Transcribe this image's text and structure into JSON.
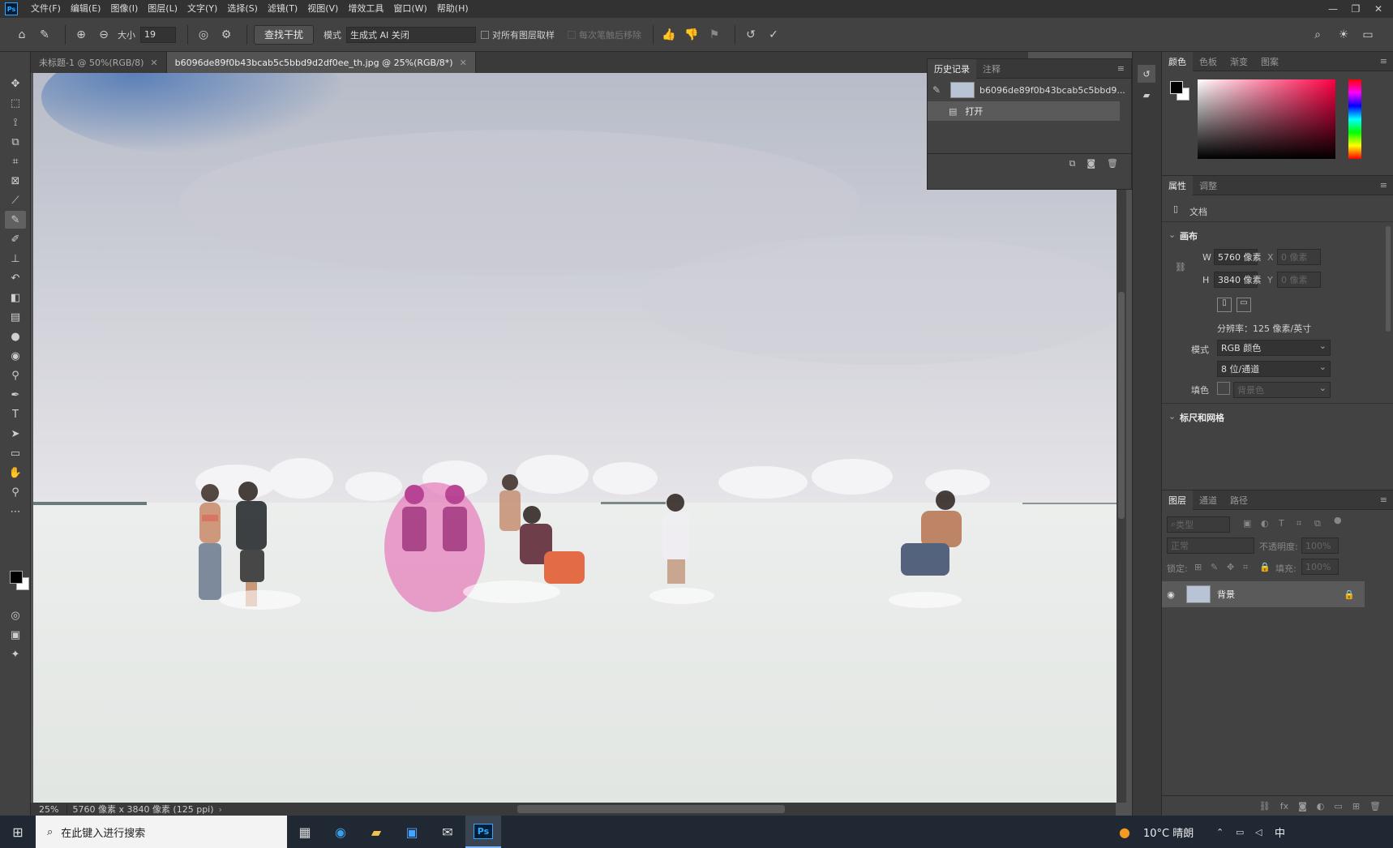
{
  "app": {
    "logo": "Ps"
  },
  "menu": [
    "文件(F)",
    "编辑(E)",
    "图像(I)",
    "图层(L)",
    "文字(Y)",
    "选择(S)",
    "滤镜(T)",
    "视图(V)",
    "增效工具",
    "窗口(W)",
    "帮助(H)"
  ],
  "options": {
    "size_label": "大小",
    "size_value": "19",
    "find_button": "查找干扰",
    "mode_label": "模式",
    "mode_value": "生成式 AI 关闭",
    "sample_all": "对所有图层取样",
    "remove_after": "每次笔触后移除"
  },
  "tabs": [
    {
      "label": "未标题-1 @ 50%(RGB/8)"
    },
    {
      "label": "b6096de89f0b43bcab5c5bbd9d2df0ee_th.jpg @ 25%(RGB/8*)"
    }
  ],
  "history": {
    "tabs": [
      "历史记录",
      "注释"
    ],
    "snapshot": "b6096de89f0b43bcab5c5bbd9...",
    "step": "打开"
  },
  "color_panel": {
    "tabs": [
      "颜色",
      "色板",
      "渐变",
      "图案"
    ],
    "fg": "#000000",
    "bg": "#ffffff"
  },
  "properties": {
    "tabs": [
      "属性",
      "调整"
    ],
    "doc_label": "文档",
    "canvas_header": "画布",
    "w_label": "W",
    "w_value": "5760 像素",
    "h_label": "H",
    "h_value": "3840 像素",
    "x_label": "X",
    "x_value": "0 像素",
    "y_label": "Y",
    "y_value": "0 像素",
    "resolution": "分辨率：125 像素/英寸",
    "mode_label": "模式",
    "mode_value": "RGB 颜色",
    "depth_value": "8 位/通道",
    "fill_label": "填色",
    "fill_value": "背景色",
    "rulers_header": "标尺和网格"
  },
  "layers": {
    "tabs": [
      "图层",
      "通道",
      "路径"
    ],
    "filter_placeholder": "类型",
    "blend": "正常",
    "opacity_label": "不透明度:",
    "opacity_value": "100%",
    "lock_label": "锁定:",
    "fill_label": "填充:",
    "fill_value": "100%",
    "layer_name": "背景"
  },
  "status": {
    "zoom": "25%",
    "doc_info": "5760 像素 x 3840 像素 (125 ppi)"
  },
  "taskbar": {
    "search_placeholder": "在此键入进行搜索",
    "weather": "10°C 晴朗",
    "ime": "中"
  }
}
